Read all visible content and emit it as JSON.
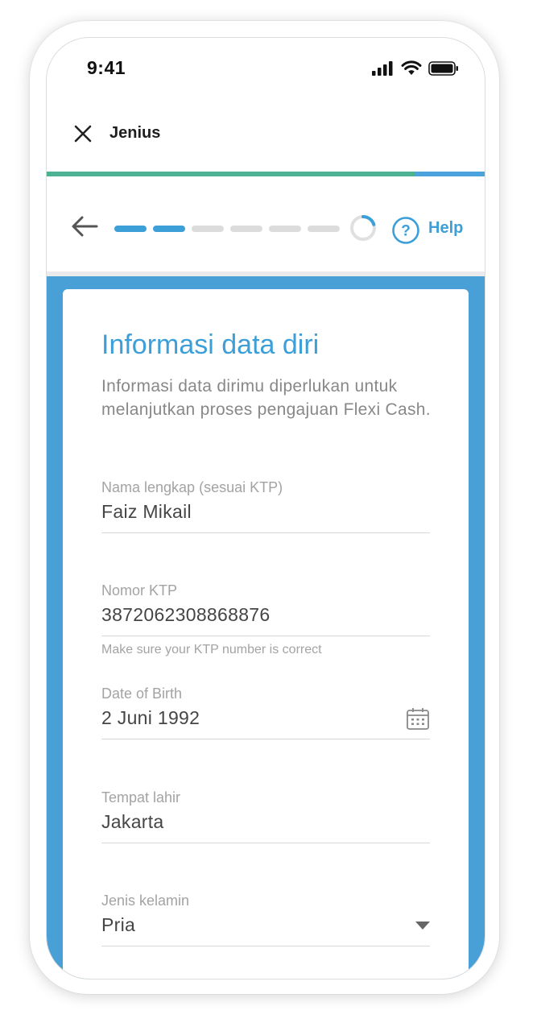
{
  "status_bar": {
    "time": "9:41"
  },
  "app_header": {
    "title": "Jenius",
    "progress_fraction": 0.84
  },
  "stepper": {
    "total_steps": 6,
    "completed_steps": 2,
    "help_label": "Help"
  },
  "form": {
    "title": "Informasi data diri",
    "description": "Informasi data dirimu diperlukan untuk melanjutkan proses pengajuan Flexi Cash.",
    "fields": {
      "full_name": {
        "label": "Nama lengkap (sesuai KTP)",
        "value": "Faiz Mikail"
      },
      "ktp_number": {
        "label": "Nomor KTP",
        "value": "3872062308868876",
        "hint": "Make sure your KTP number is correct"
      },
      "date_of_birth": {
        "label": "Date of Birth",
        "value": "2 Juni 1992",
        "icon": "calendar-icon"
      },
      "birth_place": {
        "label": "Tempat lahir",
        "value": "Jakarta"
      },
      "gender": {
        "label": "Jenis kelamin",
        "value": "Pria",
        "icon": "dropdown-arrow-icon"
      }
    }
  },
  "colors": {
    "accent": "#3d9fd8",
    "progress_green": "#4bb394",
    "content_background": "#48a0d6",
    "text_muted": "#a3a3a3"
  }
}
